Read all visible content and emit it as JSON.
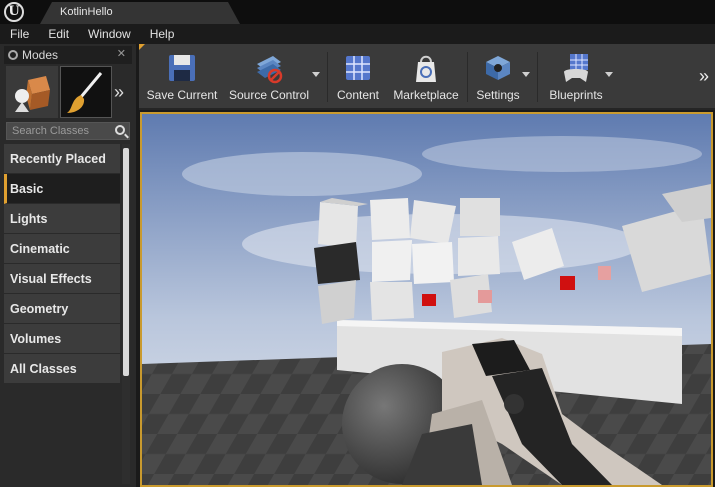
{
  "titlebar": {
    "tab_title": "KotlinHello"
  },
  "menu": [
    "File",
    "Edit",
    "Window",
    "Help"
  ],
  "modes": {
    "title": "Modes",
    "search_placeholder": "Search Classes",
    "categories": [
      "Recently Placed",
      "Basic",
      "Lights",
      "Cinematic",
      "Visual Effects",
      "Geometry",
      "Volumes",
      "All Classes"
    ],
    "active_category": "Basic"
  },
  "toolbar": {
    "items": [
      {
        "label": "Save Current",
        "icon": "save-icon"
      },
      {
        "label": "Source Control",
        "icon": "source-control-icon"
      },
      {
        "label": "Content",
        "icon": "content-icon"
      },
      {
        "label": "Marketplace",
        "icon": "marketplace-icon"
      },
      {
        "label": "Settings",
        "icon": "settings-icon"
      },
      {
        "label": "Blueprints",
        "icon": "blueprints-icon"
      }
    ]
  },
  "colors": {
    "accent": "#c99a2e",
    "panel": "#2a2a2a",
    "toolbar": "#3a3a3a"
  }
}
